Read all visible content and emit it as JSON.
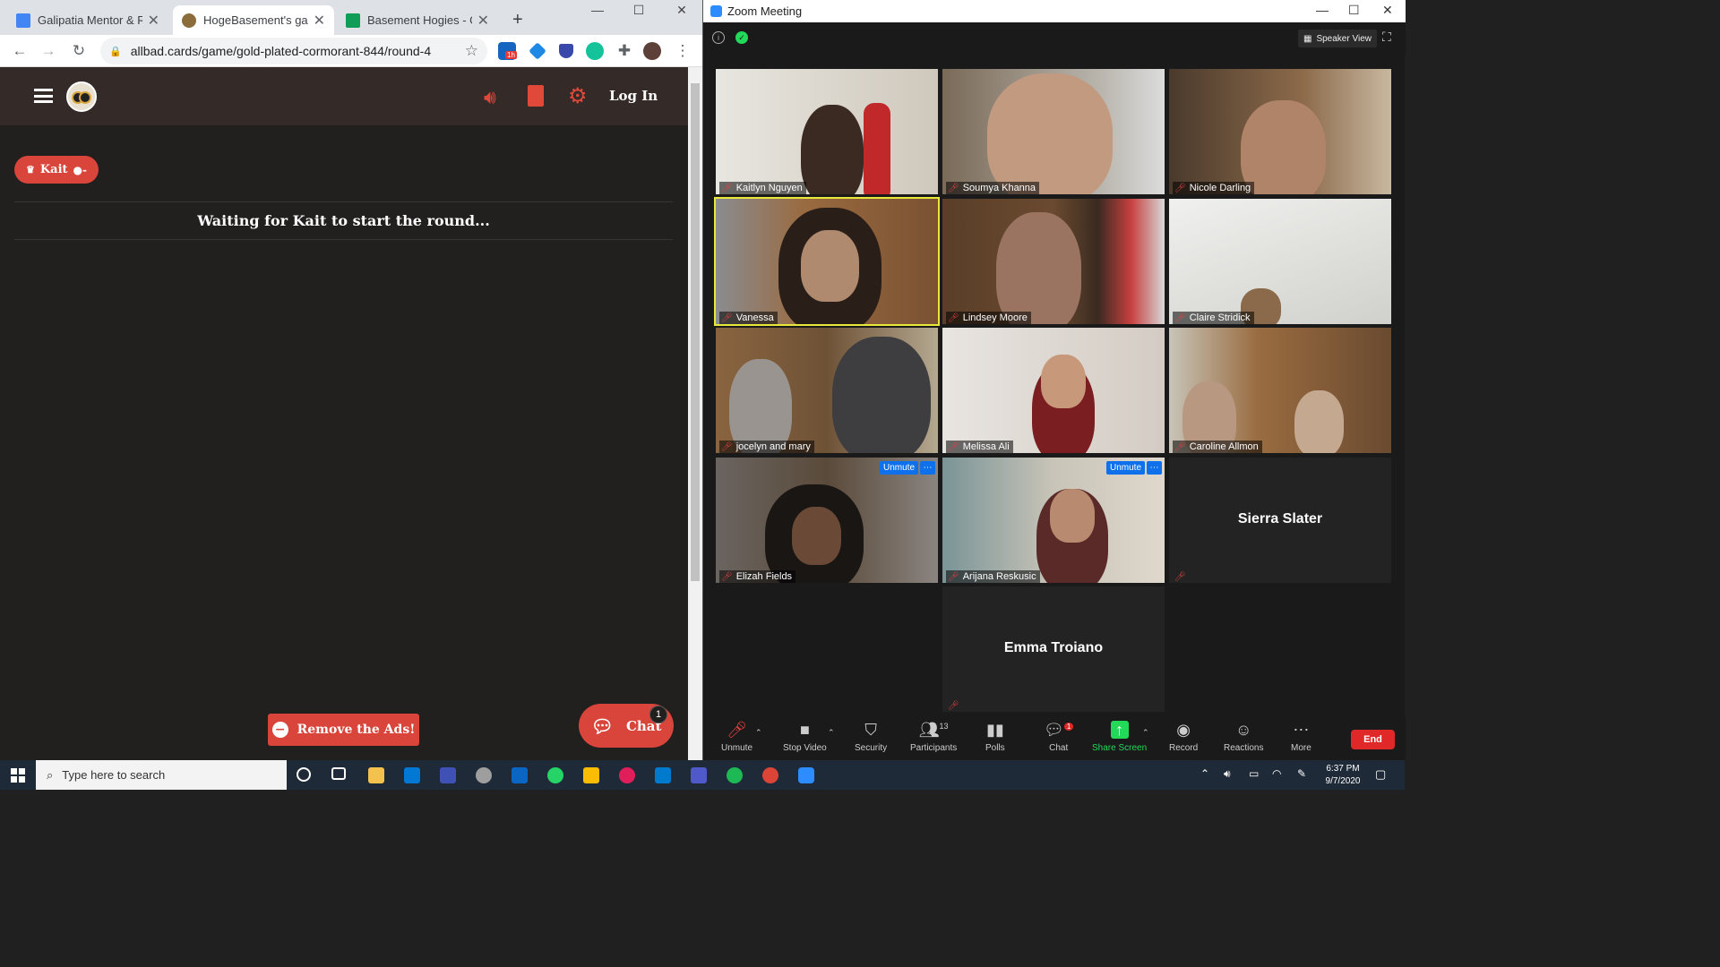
{
  "chrome": {
    "tabs": [
      {
        "title": "Galipatia Mentor & R",
        "color": "#4285f4"
      },
      {
        "title": "HogeBasement's gam",
        "color": "#8a6d3b"
      },
      {
        "title": "Basement Hogies - G",
        "color": "#0f9d58"
      }
    ],
    "url": "allbad.cards/game/gold-plated-cormorant-844/round-4",
    "ext_badge": "1h"
  },
  "site": {
    "login": "Log In",
    "player_chip": "Kait",
    "status": "Waiting for Kait to start the round...",
    "remove_ads": "Remove the Ads!",
    "chat": "Chat",
    "chat_badge": "1"
  },
  "zoom": {
    "window_title": "Zoom Meeting",
    "view_label": "Speaker View",
    "unmute_label": "Unmute",
    "participants": [
      {
        "name": "Kaitlyn Nguyen"
      },
      {
        "name": "Soumya Khanna"
      },
      {
        "name": "Nicole Darling"
      },
      {
        "name": "Vanessa"
      },
      {
        "name": "Lindsey Moore"
      },
      {
        "name": "Claire Stridick"
      },
      {
        "name": "jocelyn and mary"
      },
      {
        "name": "Melissa Ali"
      },
      {
        "name": "Caroline Allmon"
      },
      {
        "name": "Elizah Fields"
      },
      {
        "name": "Arijana Reskusic"
      },
      {
        "name": "Sierra Slater"
      },
      {
        "name": "Emma Troiano"
      }
    ],
    "toolbar": {
      "unmute": "Unmute",
      "stop_video": "Stop Video",
      "security": "Security",
      "participants": "Participants",
      "participants_count": "13",
      "polls": "Polls",
      "chat": "Chat",
      "chat_badge": "1",
      "share_screen": "Share Screen",
      "record": "Record",
      "reactions": "Reactions",
      "more": "More",
      "end": "End"
    }
  },
  "taskbar": {
    "search_placeholder": "Type here to search",
    "time": "6:37 PM",
    "date": "9/7/2020"
  }
}
